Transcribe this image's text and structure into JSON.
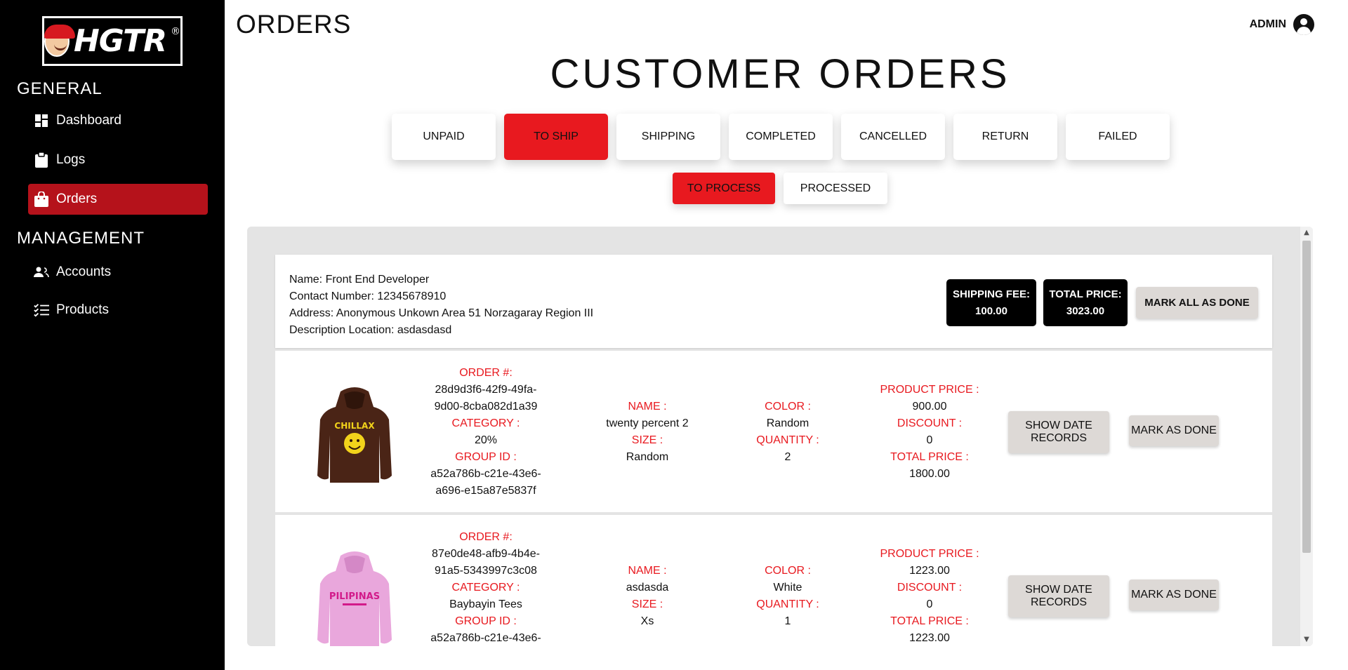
{
  "sidebar": {
    "logo_text": "HGTR",
    "logo_reg": "®",
    "sections": [
      {
        "title": "GENERAL"
      },
      {
        "title": "MANAGEMENT"
      }
    ],
    "items": [
      {
        "label": "Dashboard",
        "icon": "dashboard-icon"
      },
      {
        "label": "Logs",
        "icon": "clipboard-icon"
      },
      {
        "label": "Orders",
        "icon": "shopping-bag-icon",
        "active": true
      },
      {
        "label": "Accounts",
        "icon": "users-icon"
      },
      {
        "label": "Products",
        "icon": "checklist-icon"
      }
    ]
  },
  "header": {
    "title": "ORDERS",
    "user": "ADMIN"
  },
  "main": {
    "heading": "CUSTOMER ORDERS",
    "tabs": [
      "UNPAID",
      "TO SHIP",
      "SHIPPING",
      "COMPLETED",
      "CANCELLED",
      "RETURN",
      "FAILED"
    ],
    "active_tab": "TO SHIP",
    "subtabs": [
      "TO PROCESS",
      "PROCESSED"
    ],
    "active_subtab": "TO PROCESS"
  },
  "customer": {
    "name": "Name: Front End Developer",
    "contact": "Contact Number: 12345678910",
    "address": "Address: Anonymous Unkown Area 51 Norzagaray Region III",
    "description": "Description Location: asdasdasd",
    "shipping_fee_label": "SHIPPING FEE:",
    "shipping_fee": "100.00",
    "total_price_label": "TOTAL PRICE:",
    "total_price": "3023.00",
    "mark_all_label": "MARK ALL AS DONE"
  },
  "labels": {
    "order_no": "ORDER #:",
    "category": "CATEGORY :",
    "group_id": "GROUP ID :",
    "name": "NAME :",
    "size": "SIZE :",
    "color": "COLOR :",
    "quantity": "QUANTITY :",
    "product_price": "PRODUCT PRICE :",
    "discount": "DISCOUNT :",
    "total_price": "TOTAL PRICE :",
    "show_dates": "SHOW DATE RECORDS",
    "mark_done": "MARK AS DONE"
  },
  "orders": [
    {
      "order_no_1": "28d9d3f6-42f9-49fa-",
      "order_no_2": "9d00-8cba082d1a39",
      "category": "20%",
      "group_id_1": "a52a786b-c21e-43e6-",
      "group_id_2": "a696-e15a87e5837f",
      "name": "twenty percent 2",
      "size": "Random",
      "color": "Random",
      "quantity": "2",
      "product_price": "900.00",
      "discount": "0",
      "total_price": "1800.00",
      "image": "brown-hoodie",
      "image_color": "#4a2416",
      "print_text": "CHILLAX"
    },
    {
      "order_no_1": "87e0de48-afb9-4b4e-",
      "order_no_2": "91a5-5343997c3c08",
      "category": "Baybayin Tees",
      "group_id_1": "a52a786b-c21e-43e6-",
      "group_id_2": "",
      "name": "asdasda",
      "size": "Xs",
      "color": "White",
      "quantity": "1",
      "product_price": "1223.00",
      "discount": "0",
      "total_price": "1223.00",
      "image": "pink-hoodie",
      "image_color": "#e9a7dc",
      "print_text": "PILIPINAS"
    }
  ],
  "colors": {
    "accent": "#e8191f",
    "active_nav": "#b5121b",
    "panel_bg": "#e4e4e4"
  }
}
